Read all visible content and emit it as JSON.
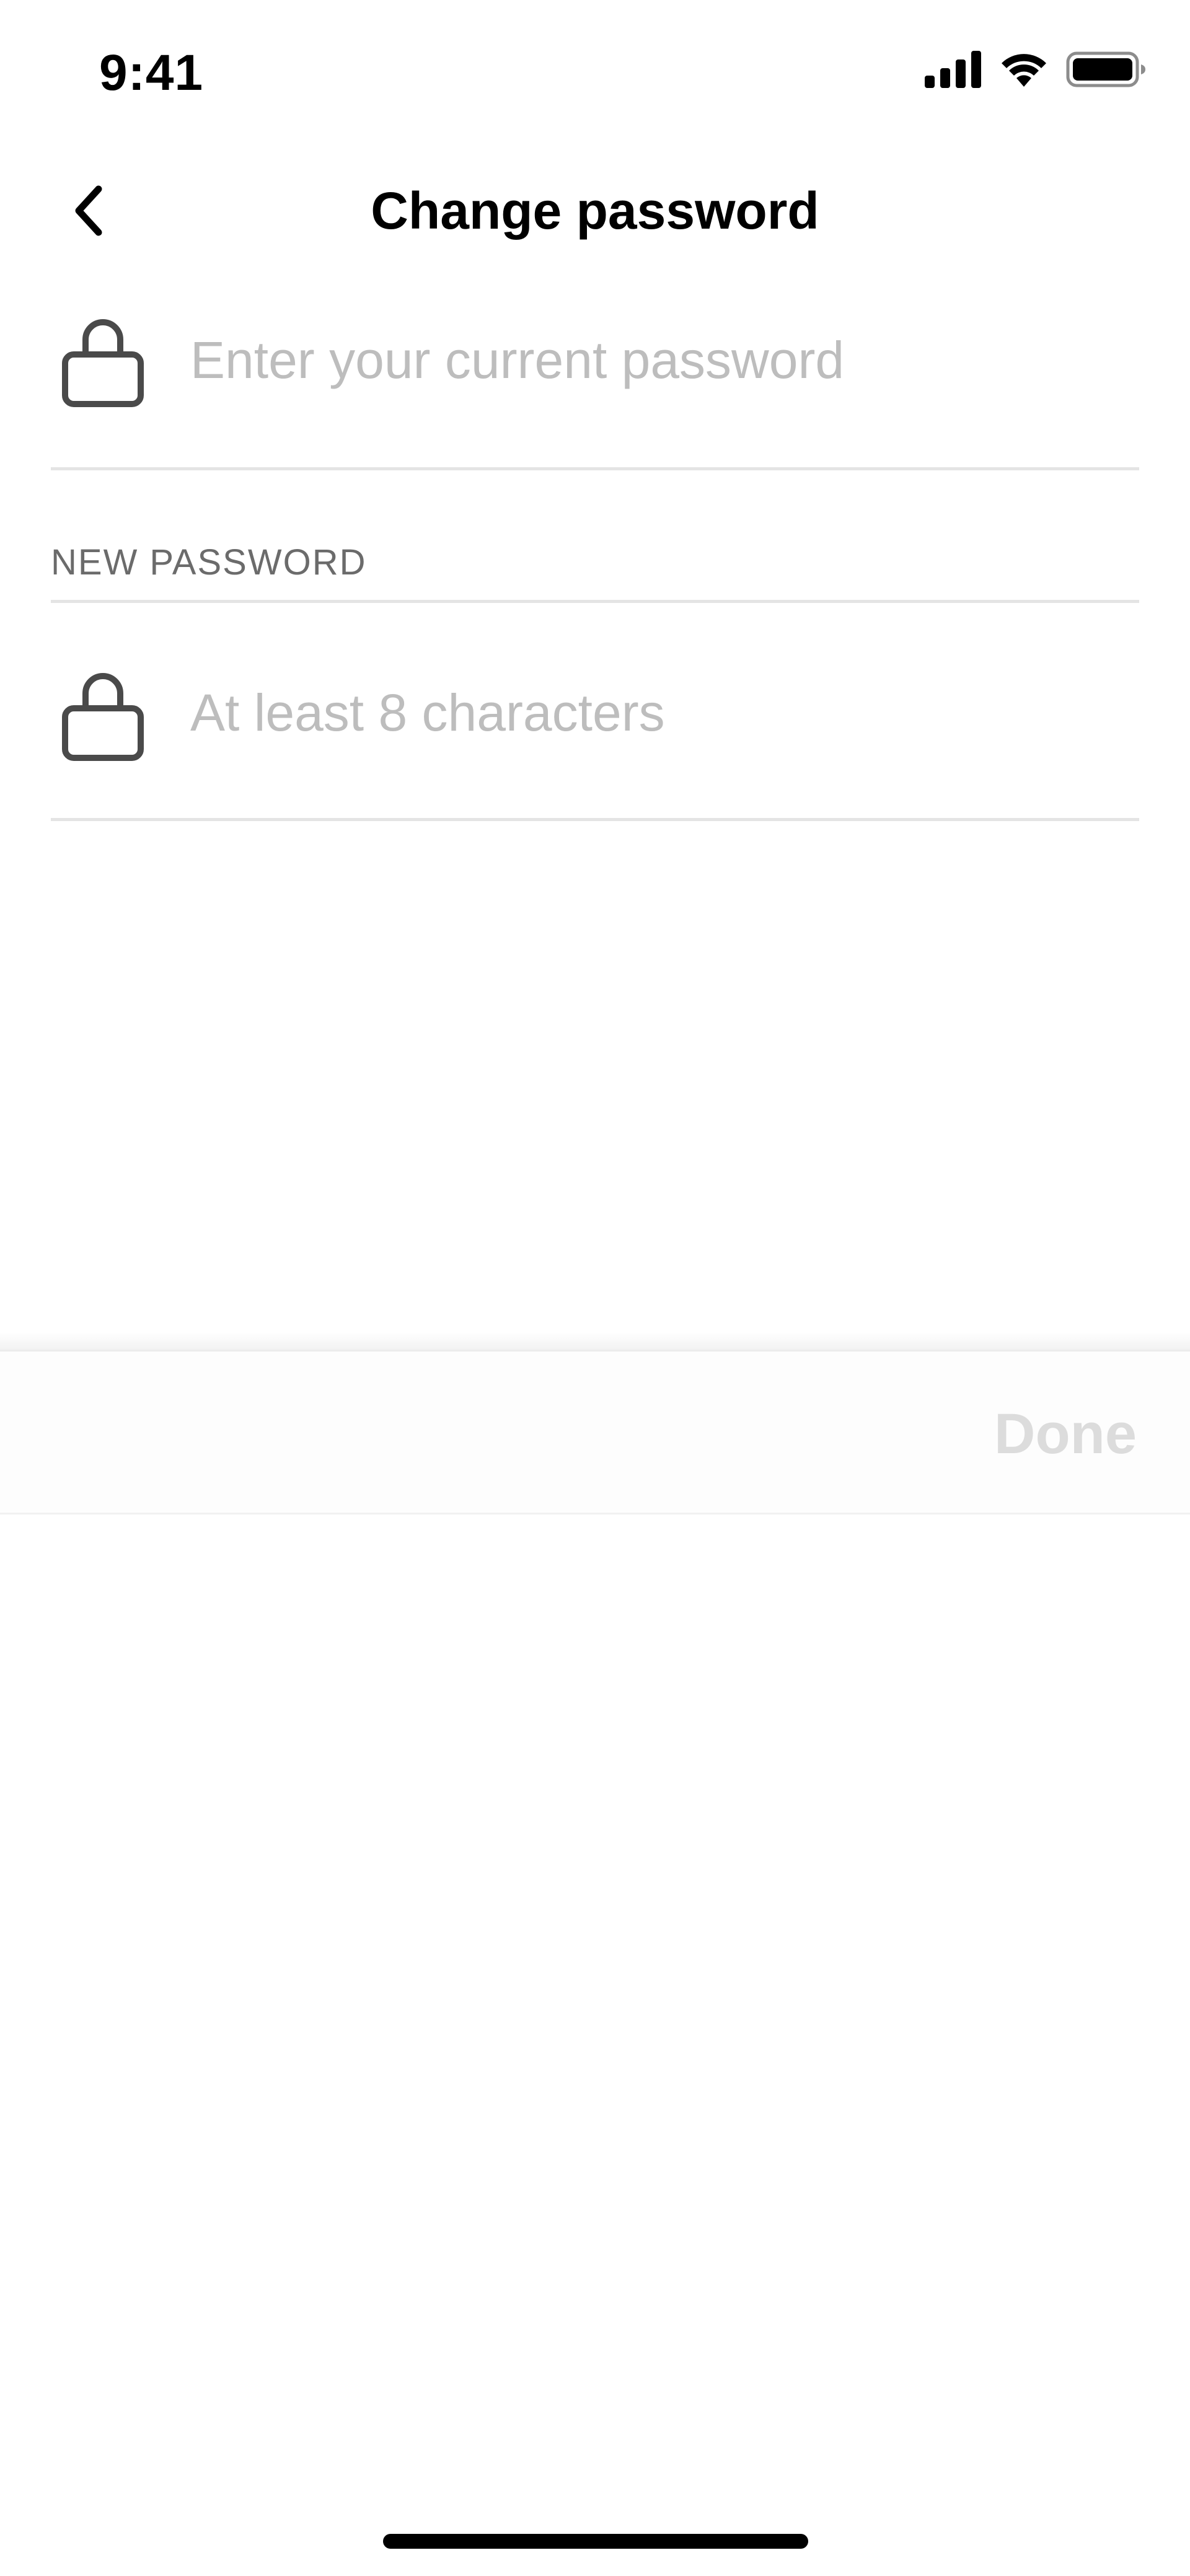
{
  "status_bar": {
    "time": "9:41",
    "icons": [
      "cellular-signal-icon",
      "wifi-icon",
      "battery-icon"
    ]
  },
  "header": {
    "title": "Change password",
    "back_icon": "chevron-left-icon"
  },
  "current_password": {
    "placeholder": "Enter your current password",
    "value": "",
    "icon": "lock-icon"
  },
  "new_password": {
    "section_label": "NEW PASSWORD",
    "placeholder": "At least 8 characters",
    "value": "",
    "icon": "lock-icon"
  },
  "accessory_bar": {
    "done_label": "Done",
    "done_enabled": false
  },
  "colors": {
    "placeholder": "#bdbdbd",
    "divider": "#e4e4e4",
    "section_label": "#6b6b6b",
    "done_disabled": "#dcdcdc",
    "icon_stroke": "#4a4a4a"
  }
}
